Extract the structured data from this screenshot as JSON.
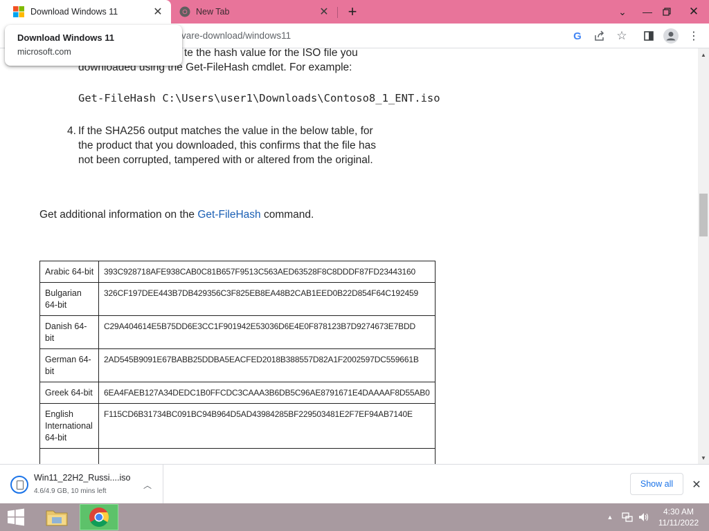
{
  "browser": {
    "tabs": [
      {
        "title": "Download Windows 11",
        "favicon": "microsoft-logo-icon",
        "active": true
      },
      {
        "title": "New Tab",
        "favicon": "chrome-icon",
        "active": false
      }
    ],
    "window_controls": {
      "minimize": "minimize-icon",
      "restore": "restore-icon",
      "close": "close-icon"
    },
    "address_fragment": "vare-download/windows11",
    "toolbar_icons": [
      "google-icon",
      "share-icon",
      "star-icon",
      "side-panel-icon",
      "profile-icon",
      "more-icon"
    ]
  },
  "hover_card": {
    "title": "Download Windows 11",
    "domain": "microsoft.com"
  },
  "content": {
    "step3_line1": "te the hash value for the ISO file you",
    "step3_line2": "downloaded using the Get-FileHash cmdlet. For example:",
    "code_example": "Get-FileHash C:\\Users\\user1\\Downloads\\Contoso8_1_ENT.iso",
    "step4_number": "4.",
    "step4_line1": "If the SHA256 output matches the value in the below table, for",
    "step4_line2": "the product that you downloaded, this confirms that the file has",
    "step4_line3": "not been corrupted, tampered with or altered from the original.",
    "additional_prefix": "Get additional information on the ",
    "additional_link": "Get-FileHash",
    "additional_suffix": " command."
  },
  "hash_table": {
    "rows": [
      {
        "lang": "Arabic 64-bit",
        "hash": "393C928718AFE938CAB0C81B657F9513C563AED63528F8C8DDDF87FD23443160"
      },
      {
        "lang": "Bulgarian 64-bit",
        "hash": "326CF197DEE443B7DB429356C3F825EB8EA48B2CAB1EED0B22D854F64C192459"
      },
      {
        "lang": "Danish 64-bit",
        "hash": "C29A404614E5B75DD6E3CC1F901942E53036D6E4E0F878123B7D9274673E7BDD"
      },
      {
        "lang": "German 64-bit",
        "hash": "2AD545B9091E67BABB25DDBA5EACFED2018B388557D82A1F2002597DC559661B"
      },
      {
        "lang": "Greek 64-bit",
        "hash": "6EA4FAEB127A34DEDC1B0FFCDC3CAAA3B6DB5C96AE8791671E4DAAAAF8D55AB0"
      },
      {
        "lang": "English International 64-bit",
        "hash": "F115CD6B31734BC091BC94B964D5AD43984285BF229503481E2F7EF94AB7140E"
      },
      {
        "lang": "",
        "hash": ""
      }
    ]
  },
  "download_shelf": {
    "file_name": "Win11_22H2_Russi....iso",
    "status": "4.6/4.9 GB, 10 mins left",
    "show_all": "Show all"
  },
  "taskbar": {
    "time": "4:30 AM",
    "date": "11/11/2022",
    "apps": [
      "file-explorer-icon",
      "chrome-icon"
    ],
    "tray_icons": [
      "tray-up-arrow-icon",
      "network-icon",
      "volume-icon"
    ]
  }
}
